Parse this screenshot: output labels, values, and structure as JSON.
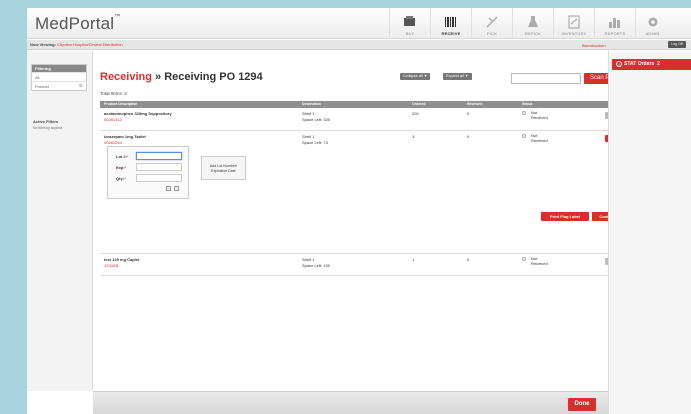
{
  "app": {
    "brand": "MedPortal",
    "brand_mark": "™"
  },
  "nav": [
    {
      "label": "BUY",
      "icon": "cart-icon"
    },
    {
      "label": "RECEIVE",
      "icon": "barcode-icon"
    },
    {
      "label": "PICK",
      "icon": "pick-icon"
    },
    {
      "label": "REPICK",
      "icon": "flask-icon"
    },
    {
      "label": "INVENTORY",
      "icon": "clipboard-icon"
    },
    {
      "label": "REPORTS",
      "icon": "bar-chart-icon"
    },
    {
      "label": "ADMIN",
      "icon": "gear-icon"
    }
  ],
  "viewing": {
    "prefix": "Now Viewing:",
    "location": "Cityview Hospital/Central Distribution"
  },
  "user": {
    "name": "Bwoolcocken",
    "logoff": "Log Off"
  },
  "sidebar": {
    "filter_title": "Filtering",
    "items": [
      {
        "label": "All"
      },
      {
        "label": "Product"
      }
    ],
    "active_filters": "Active Filters",
    "no_filter": "No filtering applied"
  },
  "main": {
    "title_link": "Receiving",
    "title_sep": "»",
    "title_rest": "Receiving PO 1294",
    "total_items": "Total Items: 3",
    "collapse_all": "Collapse all ▼",
    "expand_all": "Expand all ▼",
    "search_value": "",
    "scan_button": "Scan Product",
    "columns": [
      "Product Description",
      "Destination",
      "Ordered",
      "Received",
      "Status"
    ],
    "rows": [
      {
        "name": "acetaminophen 325mg Suppository",
        "sku": "00281312",
        "dest": "Shelf 1",
        "space": "Space Left: 320",
        "ordered": "200",
        "received": "0",
        "status_1": "Not",
        "status_2": "Received"
      },
      {
        "name": "lorazepam 1mg Tablet",
        "sku": "00281264",
        "dest": "Shelf 1",
        "space": "Space Left: 73",
        "ordered": "3",
        "received": "0",
        "status_1": "Not",
        "status_2": "Received"
      },
      {
        "name": "test 125 mg Caplet",
        "sku": "1234AB",
        "dest": "Shelf 1",
        "space": "Space Left: 100",
        "ordered": "1",
        "received": "0",
        "status_1": "Not",
        "status_2": "Received"
      }
    ],
    "form": {
      "lot_label": "Lot #:",
      "exp_label": "Exp:",
      "qty_label": "Qty:",
      "add_lot_1": "Add Lot Number/",
      "add_lot_2": "Expiration Date",
      "print_flag": "Print Flag Label",
      "continue": "Continue"
    },
    "done": "Done"
  },
  "right": {
    "stat_label": "STAT Orders",
    "stat_count": "2"
  },
  "colors": {
    "accent": "#d92e2e",
    "bg_frame": "#a9d3de",
    "header_gray": "#8f8f8f"
  }
}
